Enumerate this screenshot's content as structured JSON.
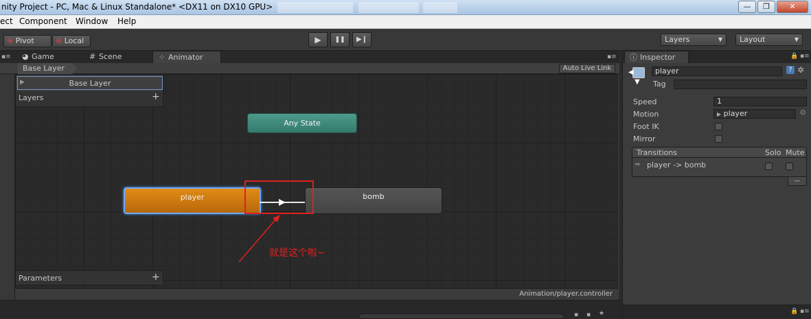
{
  "window": {
    "title": "nity Project - PC, Mac & Linux Standalone* <DX11 on DX10 GPU>",
    "minimize": "—",
    "maximize": "❐",
    "close": "✕"
  },
  "menu": {
    "items": [
      "ect",
      "Component",
      "Window",
      "Help"
    ]
  },
  "toolbar": {
    "pivot_label": "Pivot",
    "local_label": "Local",
    "play_icon": "▶",
    "pause_icon": "❚❚",
    "step_icon": "▶❙",
    "layers_label": "Layers",
    "layout_label": "Layout"
  },
  "tabs": {
    "game": "Game",
    "scene": "Scene",
    "animator": "Animator",
    "inspector": "Inspector"
  },
  "animator": {
    "breadcrumb": "Base Layer",
    "auto_live_link": "Auto Live Link",
    "layer_item": "Base Layer",
    "layers_header": "Layers",
    "parameters_header": "Parameters",
    "add_symbol": "+",
    "status_path": "Animation/player.controller",
    "states": {
      "any_state": "Any State",
      "player": "player",
      "bomb": "bomb"
    },
    "annotation_text": "就是这个啦~"
  },
  "inspector": {
    "object_name": "player",
    "tag_label": "Tag",
    "speed_label": "Speed",
    "speed_value": "1",
    "motion_label": "Motion",
    "motion_value": "player",
    "foot_ik_label": "Foot IK",
    "mirror_label": "Mirror",
    "transitions_header": "Transitions",
    "solo_label": "Solo",
    "mute_label": "Mute",
    "transition_item": "player -> bomb",
    "remove_symbol": "—"
  },
  "colors": {
    "player_state": "#d07a10",
    "bomb_state": "#4a4a4a",
    "any_state": "#3f8a7c",
    "annotation": "#e02020"
  }
}
